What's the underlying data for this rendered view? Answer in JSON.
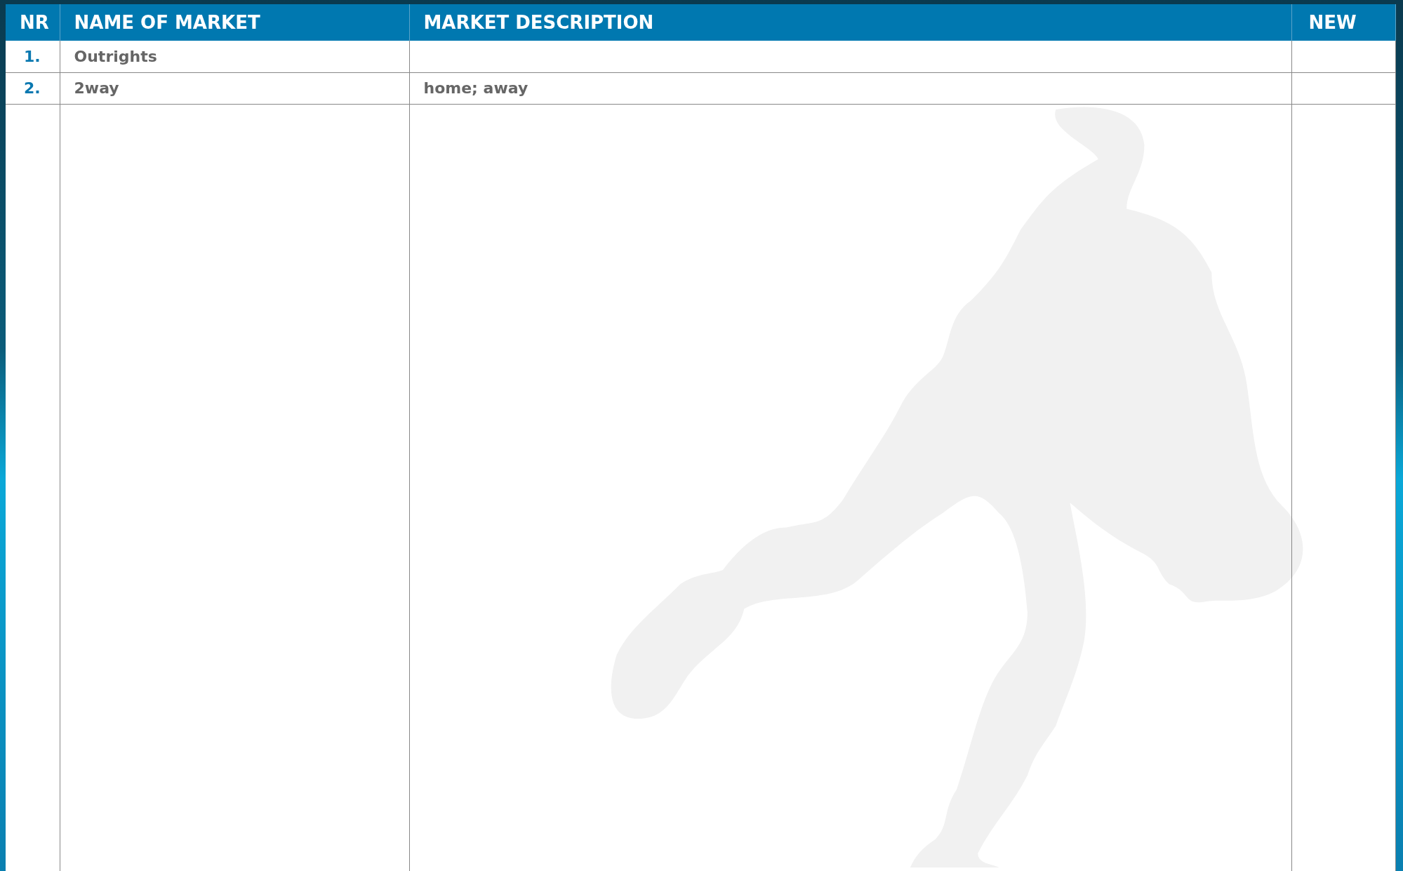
{
  "table": {
    "columns": [
      "NR",
      "NAME OF MARKET",
      "MARKET DESCRIPTION",
      "NEW"
    ],
    "rows": [
      {
        "nr": "1.",
        "name": "Outrights"
      },
      {
        "nr": "2.",
        "name": "2way",
        "description": "home; away"
      }
    ]
  }
}
